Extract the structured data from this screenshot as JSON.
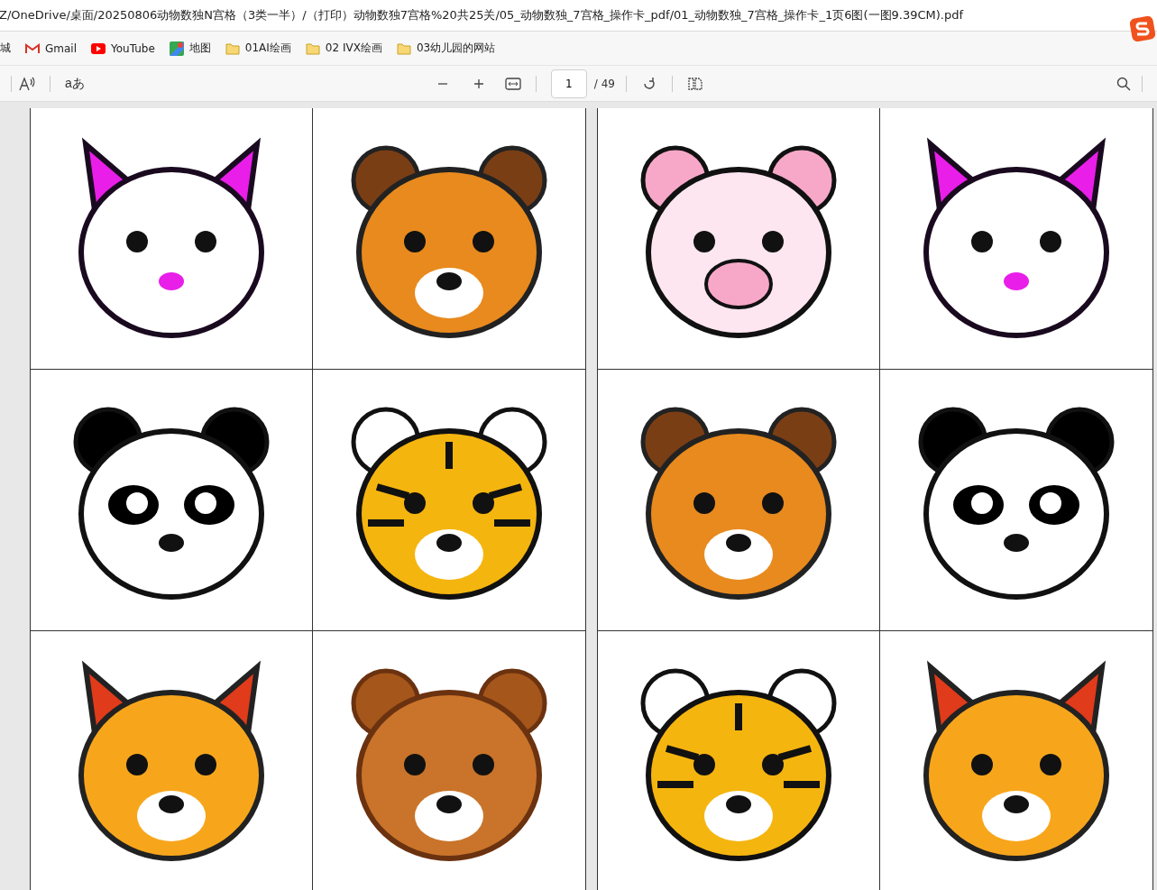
{
  "address_bar": {
    "url": "Z/OneDrive/桌面/20250806动物数独N宫格（3类一半）/（打印）动物数独7宫格%20共25关/05_动物数独_7宫格_操作卡_pdf/01_动物数独_7宫格_操作卡_1页6图(一图9.39CM).pdf"
  },
  "bookmarks": [
    {
      "kind": "cut",
      "label": "城"
    },
    {
      "kind": "gmail",
      "label": "Gmail"
    },
    {
      "kind": "youtube",
      "label": "YouTube"
    },
    {
      "kind": "maps",
      "label": "地图"
    },
    {
      "kind": "folder",
      "label": "01AI绘画"
    },
    {
      "kind": "folder",
      "label": "02 IVX绘画"
    },
    {
      "kind": "folder",
      "label": "03幼儿园的网站"
    }
  ],
  "pdf_toolbar": {
    "translate_label": "aあ",
    "page_number": "1",
    "page_count": "/ 49"
  },
  "pages": [
    {
      "cells": [
        {
          "kind": "cat"
        },
        {
          "kind": "dog"
        },
        {
          "kind": "panda"
        },
        {
          "kind": "tiger"
        },
        {
          "kind": "fox"
        },
        {
          "kind": "bear"
        }
      ]
    },
    {
      "cells": [
        {
          "kind": "pig"
        },
        {
          "kind": "cat"
        },
        {
          "kind": "dog"
        },
        {
          "kind": "panda"
        },
        {
          "kind": "tiger"
        },
        {
          "kind": "fox"
        }
      ]
    }
  ]
}
